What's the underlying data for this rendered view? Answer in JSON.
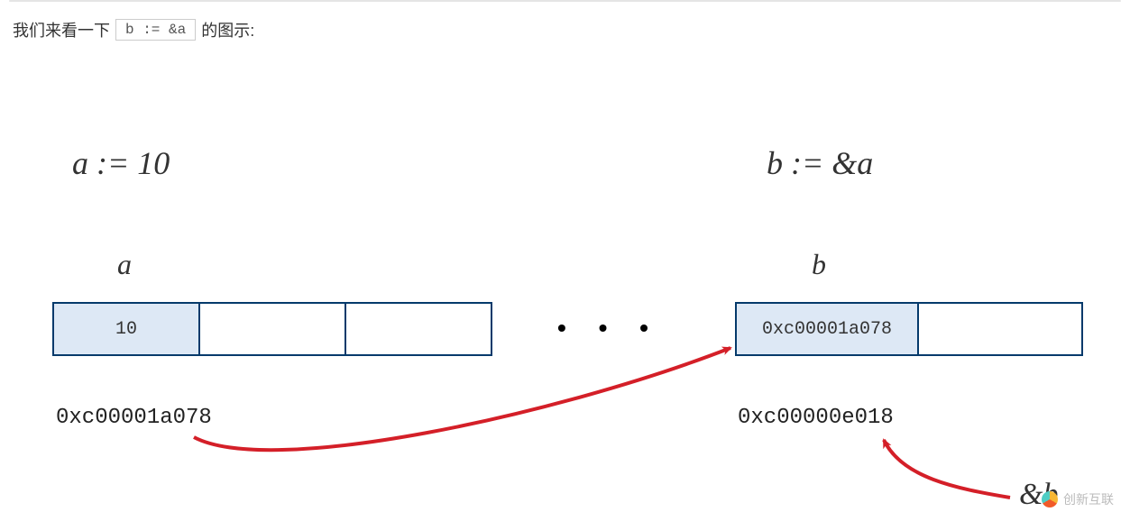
{
  "intro": {
    "prefix": "我们来看一下",
    "code": "b := &a",
    "suffix": "的图示:"
  },
  "diagram": {
    "decl_a": "a := 10",
    "decl_b": "b := &a",
    "var_a": "a",
    "var_b": "b",
    "mem_a_cell0": "10",
    "mem_b_cell0": "0xc00001a078",
    "dots": "• • •",
    "addr_a": "0xc00001a078",
    "addr_b": "0xc00000e018",
    "amp_b": "&b"
  },
  "watermark": "创新互联"
}
